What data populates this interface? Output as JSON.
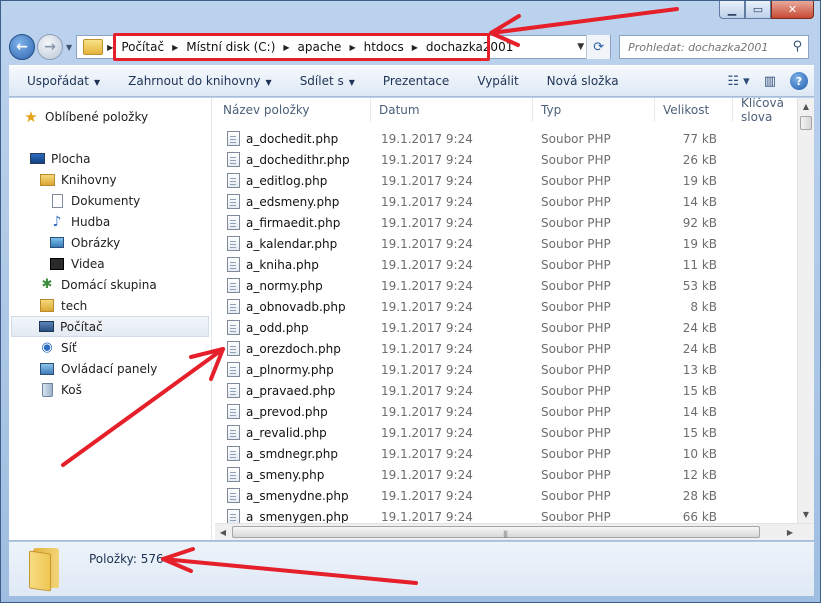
{
  "window": {
    "caption_buttons": [
      "minimize",
      "maximize",
      "close"
    ]
  },
  "address_bar": {
    "crumbs": [
      "Počítač",
      "Místní disk (C:)",
      "apache",
      "htdocs",
      "dochazka2001"
    ]
  },
  "search": {
    "placeholder": "Prohledat: dochazka2001"
  },
  "toolbar": {
    "organize": "Uspořádat",
    "include_library": "Zahrnout do knihovny",
    "share": "Sdílet s",
    "slideshow": "Prezentace",
    "burn": "Vypálit",
    "new_folder": "Nová složka"
  },
  "sidebar": {
    "items": [
      {
        "label": "Oblíbené položky",
        "icon": "star-icon"
      },
      {
        "label": "Plocha",
        "icon": "desktop-icon"
      },
      {
        "label": "Knihovny",
        "icon": "library-icon"
      },
      {
        "label": "Dokumenty",
        "icon": "documents-icon"
      },
      {
        "label": "Hudba",
        "icon": "music-icon"
      },
      {
        "label": "Obrázky",
        "icon": "pictures-icon"
      },
      {
        "label": "Videa",
        "icon": "video-icon"
      },
      {
        "label": "Domácí skupina",
        "icon": "homegroup-icon"
      },
      {
        "label": "tech",
        "icon": "user-folder-icon"
      },
      {
        "label": "Počítač",
        "icon": "computer-icon",
        "selected": true
      },
      {
        "label": "Síť",
        "icon": "network-icon"
      },
      {
        "label": "Ovládací panely",
        "icon": "control-panel-icon"
      },
      {
        "label": "Koš",
        "icon": "recycle-bin-icon"
      }
    ]
  },
  "columns": {
    "name": "Název položky",
    "date": "Datum",
    "type": "Typ",
    "size": "Velikost",
    "keywords": "Klíčová slova"
  },
  "files": [
    {
      "name": "a_dochedit.php",
      "date": "19.1.2017 9:24",
      "type": "Soubor PHP",
      "size": "77 kB"
    },
    {
      "name": "a_dochedithr.php",
      "date": "19.1.2017 9:24",
      "type": "Soubor PHP",
      "size": "26 kB"
    },
    {
      "name": "a_editlog.php",
      "date": "19.1.2017 9:24",
      "type": "Soubor PHP",
      "size": "19 kB"
    },
    {
      "name": "a_edsmeny.php",
      "date": "19.1.2017 9:24",
      "type": "Soubor PHP",
      "size": "14 kB"
    },
    {
      "name": "a_firmaedit.php",
      "date": "19.1.2017 9:24",
      "type": "Soubor PHP",
      "size": "92 kB"
    },
    {
      "name": "a_kalendar.php",
      "date": "19.1.2017 9:24",
      "type": "Soubor PHP",
      "size": "19 kB"
    },
    {
      "name": "a_kniha.php",
      "date": "19.1.2017 9:24",
      "type": "Soubor PHP",
      "size": "11 kB"
    },
    {
      "name": "a_normy.php",
      "date": "19.1.2017 9:24",
      "type": "Soubor PHP",
      "size": "53 kB"
    },
    {
      "name": "a_obnovadb.php",
      "date": "19.1.2017 9:24",
      "type": "Soubor PHP",
      "size": "8 kB"
    },
    {
      "name": "a_odd.php",
      "date": "19.1.2017 9:24",
      "type": "Soubor PHP",
      "size": "24 kB"
    },
    {
      "name": "a_orezdoch.php",
      "date": "19.1.2017 9:24",
      "type": "Soubor PHP",
      "size": "24 kB"
    },
    {
      "name": "a_plnormy.php",
      "date": "19.1.2017 9:24",
      "type": "Soubor PHP",
      "size": "13 kB"
    },
    {
      "name": "a_pravaed.php",
      "date": "19.1.2017 9:24",
      "type": "Soubor PHP",
      "size": "15 kB"
    },
    {
      "name": "a_prevod.php",
      "date": "19.1.2017 9:24",
      "type": "Soubor PHP",
      "size": "14 kB"
    },
    {
      "name": "a_revalid.php",
      "date": "19.1.2017 9:24",
      "type": "Soubor PHP",
      "size": "15 kB"
    },
    {
      "name": "a_smdnegr.php",
      "date": "19.1.2017 9:24",
      "type": "Soubor PHP",
      "size": "10 kB"
    },
    {
      "name": "a_smeny.php",
      "date": "19.1.2017 9:24",
      "type": "Soubor PHP",
      "size": "12 kB"
    },
    {
      "name": "a_smenydne.php",
      "date": "19.1.2017 9:24",
      "type": "Soubor PHP",
      "size": "28 kB"
    },
    {
      "name": "a_smenygen.php",
      "date": "19.1.2017 9:24",
      "type": "Soubor PHP",
      "size": "66 kB"
    }
  ],
  "details": {
    "items_count": "Položky: 576"
  },
  "colors": {
    "annotation_red": "#e5202a",
    "frame_blue": "#bcd3ee"
  }
}
